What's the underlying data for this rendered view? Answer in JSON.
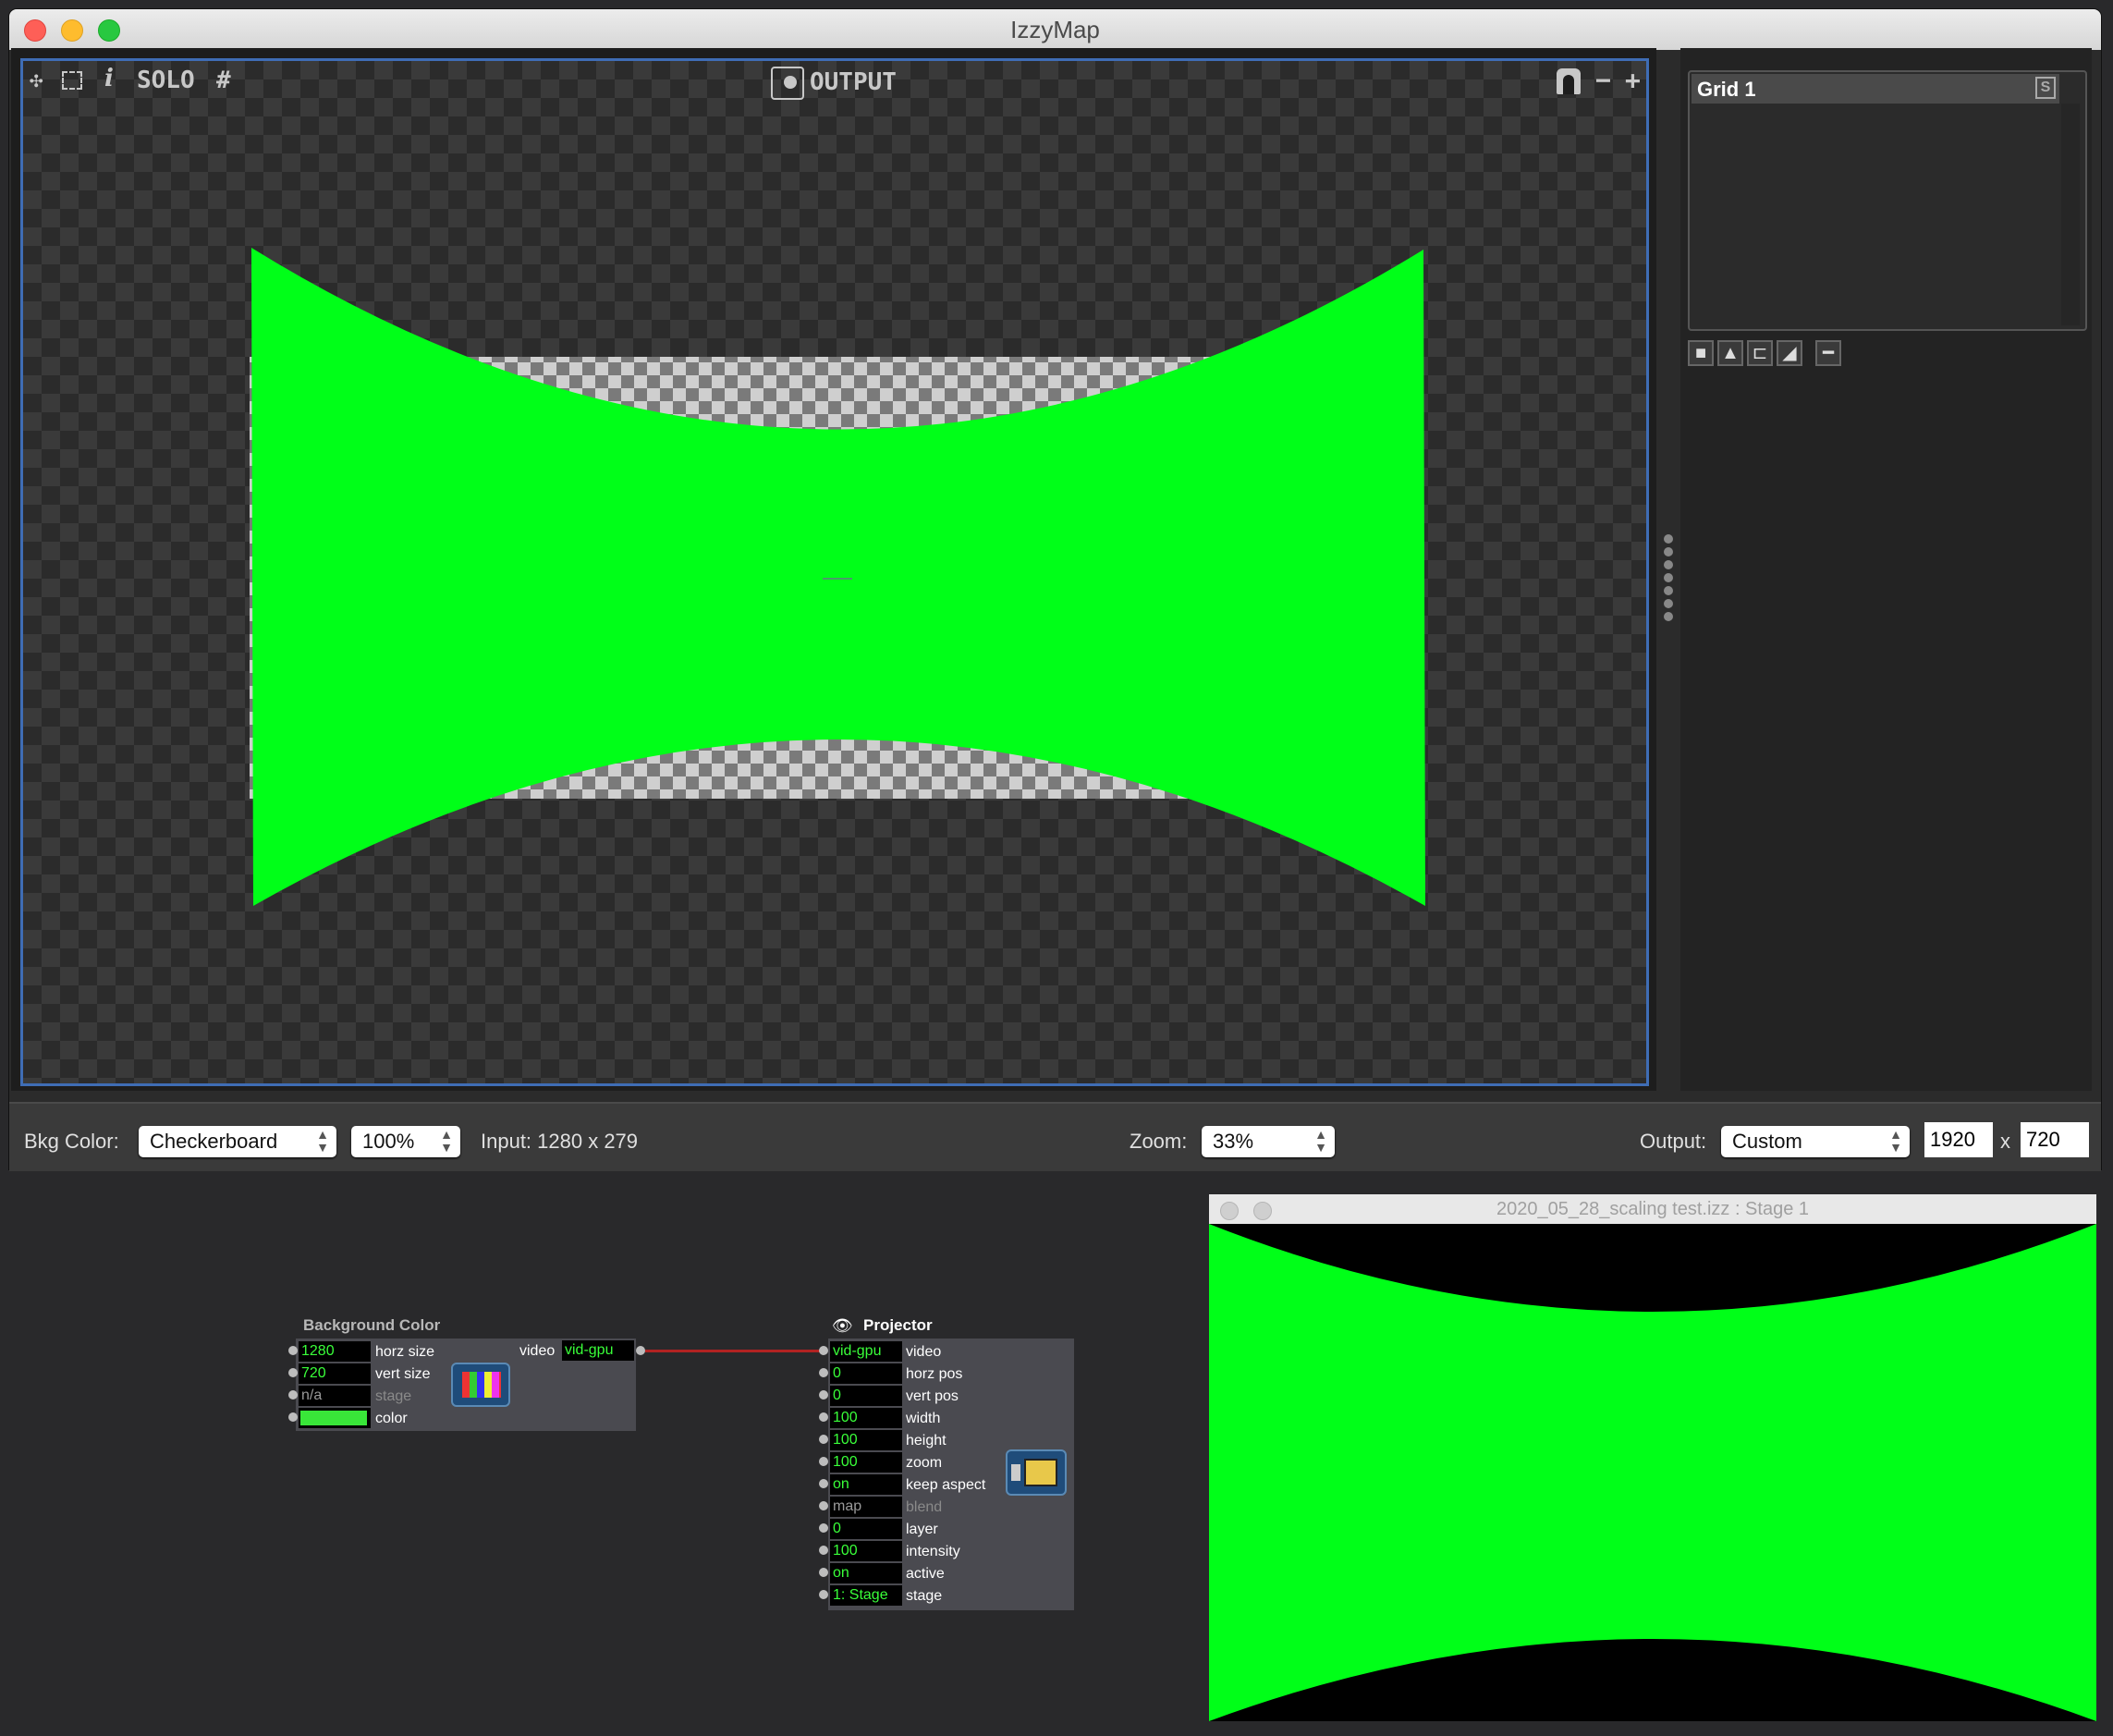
{
  "app": {
    "title": "IzzyMap"
  },
  "toolbar": {
    "solo_label": "SOLO",
    "grid_label": "#",
    "info_label": "i",
    "output_label": "OUTPUT",
    "zoom_minus": "−",
    "zoom_plus": "+"
  },
  "right_panel": {
    "grid_name": "Grid 1",
    "solo_badge": "S"
  },
  "bottom_bar": {
    "bkg_color_label": "Bkg Color:",
    "bkg_color_value": "Checkerboard",
    "opacity_value": "100%",
    "input_text": "Input:  1280 x 279",
    "zoom_label": "Zoom:",
    "zoom_value": "33%",
    "output_label": "Output:",
    "output_value": "Custom",
    "output_width": "1920",
    "output_x": "x",
    "output_height": "720"
  },
  "colors": {
    "accent_green": "#00ff18",
    "canvas_border": "#3f6db5",
    "window_bg": "#2b2b2b"
  },
  "actors": {
    "background_color": {
      "title": "Background Color",
      "inputs": [
        {
          "value": "1280",
          "label": "horz size",
          "dim": false
        },
        {
          "value": "720",
          "label": "vert size",
          "dim": false
        },
        {
          "value": "n/a",
          "label": "stage",
          "dim": true
        },
        {
          "value": "",
          "label": "color",
          "dim": false
        }
      ],
      "output": {
        "label": "video",
        "value": "vid-gpu"
      }
    },
    "projector": {
      "title": "Projector",
      "inputs": [
        {
          "value": "vid-gpu",
          "label": "video",
          "dim": false
        },
        {
          "value": "0",
          "label": "horz pos",
          "dim": false
        },
        {
          "value": "0",
          "label": "vert pos",
          "dim": false
        },
        {
          "value": "100",
          "label": "width",
          "dim": false
        },
        {
          "value": "100",
          "label": "height",
          "dim": false
        },
        {
          "value": "100",
          "label": "zoom",
          "dim": false
        },
        {
          "value": "on",
          "label": "keep aspect",
          "dim": false
        },
        {
          "value": "map",
          "label": "blend",
          "dim": true
        },
        {
          "value": "0",
          "label": "layer",
          "dim": false
        },
        {
          "value": "100",
          "label": "intensity",
          "dim": false
        },
        {
          "value": "on",
          "label": "active",
          "dim": false
        },
        {
          "value": "1: Stage",
          "label": "stage",
          "dim": false
        }
      ]
    }
  },
  "stage_window": {
    "title": "2020_05_28_scaling test.izz : Stage 1"
  }
}
